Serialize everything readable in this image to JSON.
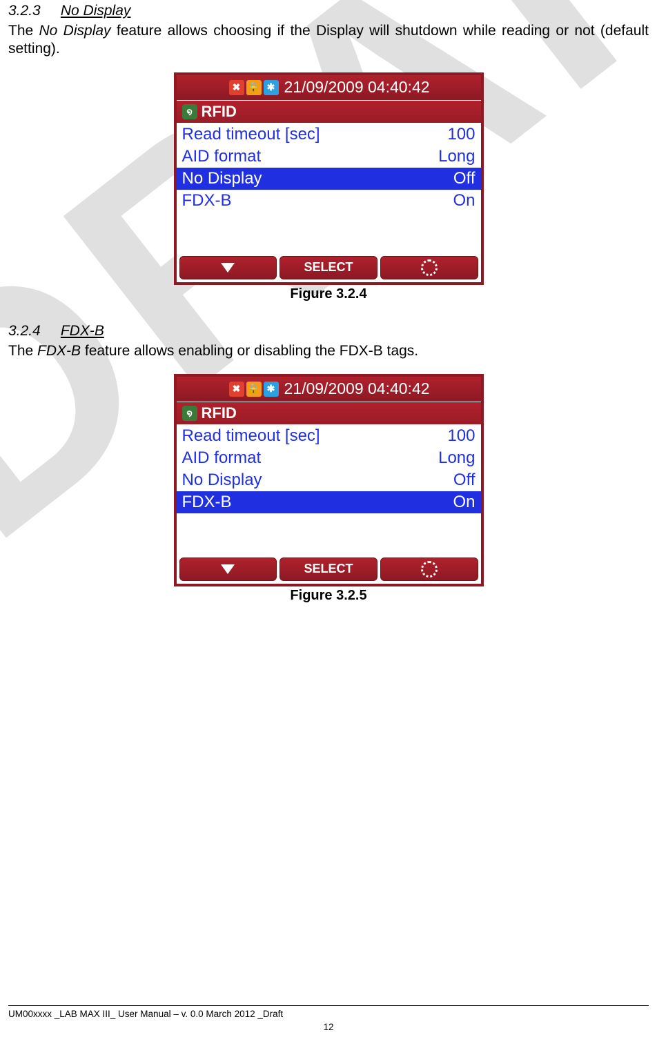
{
  "watermark": "DRAFT",
  "section1": {
    "number": "3.2.3",
    "title": "No Display",
    "text_pre": "The ",
    "text_em": "No Display",
    "text_post": " feature allows choosing if the Display will shutdown while reading or not (default setting).",
    "caption": "Figure 3.2.4"
  },
  "section2": {
    "number": "3.2.4",
    "title": "FDX-B",
    "text_pre": "The ",
    "text_em": "FDX-B",
    "text_post": " feature allows enabling or disabling the FDX-B tags.",
    "caption": "Figure 3.2.5"
  },
  "device": {
    "datetime": "21/09/2009 04:40:42",
    "header": "RFID",
    "rows": [
      {
        "label": "Read timeout [sec]",
        "value": "100"
      },
      {
        "label": "AID format",
        "value": "Long"
      },
      {
        "label": "No Display",
        "value": "Off"
      },
      {
        "label": "FDX-B",
        "value": "On"
      }
    ],
    "select_label": "SELECT",
    "fig1_selected_index": 2,
    "fig2_selected_index": 3
  },
  "footer": {
    "line": "UM00xxxx _LAB MAX III_ User Manual – v. 0.0 March 2012 _Draft",
    "page": "12"
  }
}
